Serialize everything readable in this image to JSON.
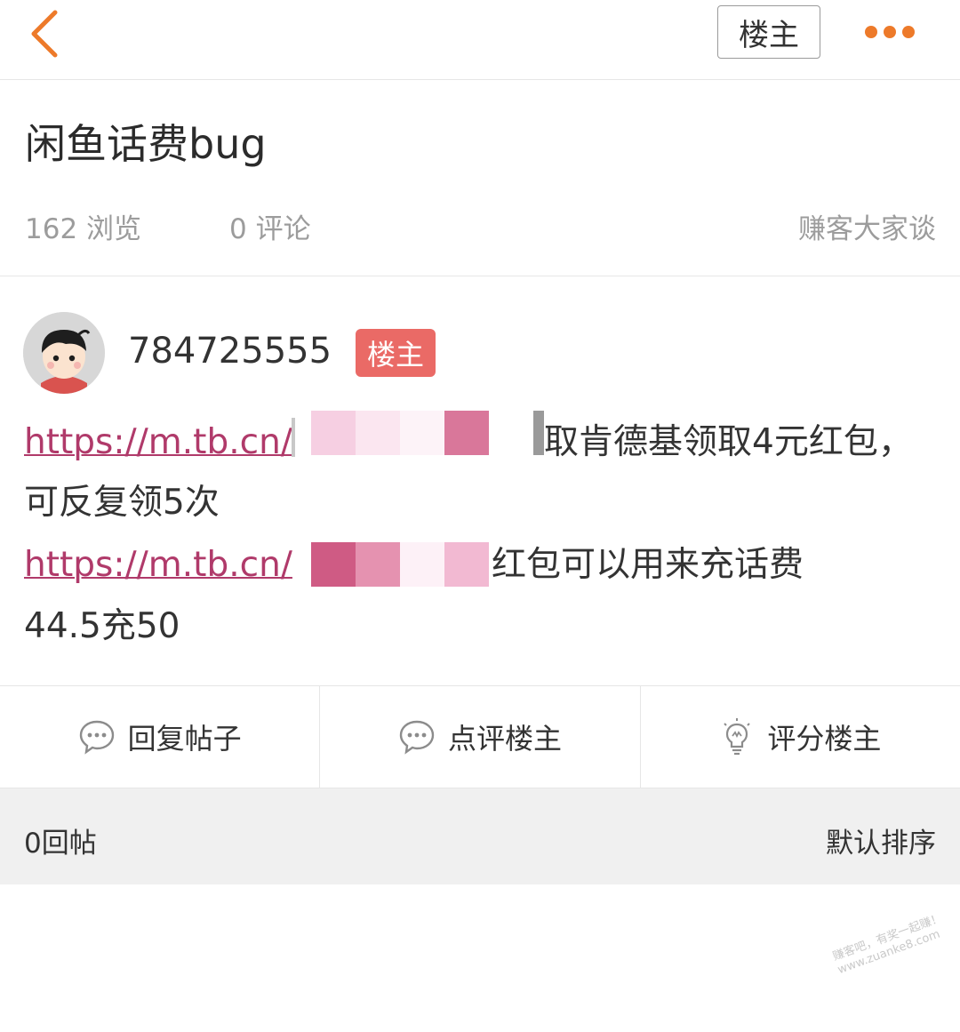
{
  "header": {
    "back_icon": "chevron-left-icon",
    "louzhu_label": "楼主",
    "more_icon": "more-dots-icon",
    "accent_color": "#ed7a2a"
  },
  "post": {
    "title": "闲鱼话费bug",
    "views": "162 浏览",
    "comments": "0 评论",
    "board": "赚客大家谈"
  },
  "author": {
    "username": "784725555",
    "badge": "楼主",
    "badge_color": "#ea6a66"
  },
  "content": {
    "line1_link": "https://m.tb.cn/",
    "line1_text": "取肯德基领取4元红包，",
    "line2_text": "可反复领5次",
    "line3_link": "https://m.tb.cn/",
    "line3_text": "红包可以用来充话费",
    "line4_text": "44.5充50"
  },
  "actions": [
    {
      "label": "回复帖子",
      "icon": "chat-bubble-icon"
    },
    {
      "label": "点评楼主",
      "icon": "chat-bubble-icon"
    },
    {
      "label": "评分楼主",
      "icon": "lightbulb-icon"
    }
  ],
  "replies": {
    "count_label": "0回帖",
    "sort_label": "默认排序"
  },
  "watermark": {
    "line1": "赚客吧，有奖一起赚！",
    "line2": "www.zuanke8.com"
  }
}
